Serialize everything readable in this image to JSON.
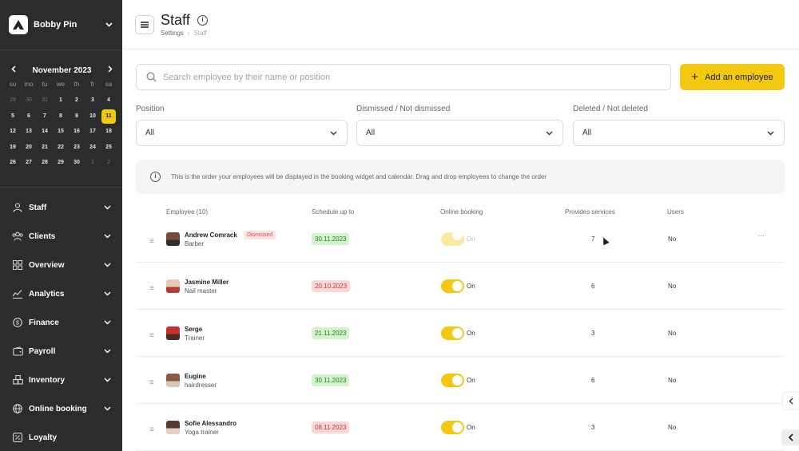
{
  "account": {
    "name": "Bobby Pin"
  },
  "calendar": {
    "month_label": "November 2023",
    "prev_icon": "chevron-left-icon",
    "next_icon": "chevron-right-icon",
    "weekdays": [
      "su",
      "mo",
      "tu",
      "we",
      "th",
      "fr",
      "sa"
    ],
    "weeks": [
      [
        "29",
        "30",
        "31",
        "1",
        "2",
        "3",
        "4"
      ],
      [
        "5",
        "6",
        "7",
        "8",
        "9",
        "10",
        "11"
      ],
      [
        "12",
        "13",
        "14",
        "15",
        "16",
        "17",
        "18"
      ],
      [
        "19",
        "20",
        "21",
        "22",
        "23",
        "24",
        "25"
      ],
      [
        "26",
        "27",
        "28",
        "29",
        "30",
        "1",
        "2"
      ]
    ],
    "selected_day": "11"
  },
  "nav": {
    "items": [
      {
        "label": "Staff",
        "icon": "user-icon"
      },
      {
        "label": "Clients",
        "icon": "users-icon"
      },
      {
        "label": "Overview",
        "icon": "grid-icon"
      },
      {
        "label": "Analytics",
        "icon": "analytics-icon"
      },
      {
        "label": "Finance",
        "icon": "dollar-icon"
      },
      {
        "label": "Payroll",
        "icon": "wallet-icon"
      },
      {
        "label": "Inventory",
        "icon": "box-icon"
      },
      {
        "label": "Online booking",
        "icon": "globe-icon"
      },
      {
        "label": "Loyalty",
        "icon": "percent-icon"
      }
    ]
  },
  "header": {
    "title": "Staff",
    "breadcrumb": [
      "Settings",
      "Staff"
    ]
  },
  "search": {
    "placeholder": "Search employee by their name or position"
  },
  "add_button": {
    "label": "Add an employee"
  },
  "filters": [
    {
      "label": "Position",
      "value": "All"
    },
    {
      "label": "Dismissed / Not dismissed",
      "value": "All"
    },
    {
      "label": "Deleted / Not deleted",
      "value": "All"
    }
  ],
  "notice": {
    "text": "This is the order your employees will be displayed in the booking widget and calendar. Drag and drop employees to change the order"
  },
  "table": {
    "headers": {
      "employee": "Employee (10)",
      "schedule": "Schedule up to",
      "online": "Online booking",
      "services": "Provides services",
      "users": "Users"
    },
    "rows": [
      {
        "name": "Andrew Comrack",
        "position": "Barber",
        "badge": "Dismissed",
        "schedule": "30.11.2023",
        "schedule_ok": true,
        "online": "On",
        "online_enabled": false,
        "services": "7",
        "users": "No",
        "more": "···"
      },
      {
        "name": "Jasmine Miller",
        "position": "Nail master",
        "badge": "",
        "schedule": "20.10.2023",
        "schedule_ok": false,
        "online": "On",
        "online_enabled": true,
        "services": "6",
        "users": "No",
        "more": ""
      },
      {
        "name": "Serge",
        "position": "Trainer",
        "badge": "",
        "schedule": "21.11.2023",
        "schedule_ok": true,
        "online": "On",
        "online_enabled": true,
        "services": "3",
        "users": "No",
        "more": ""
      },
      {
        "name": "Eugine",
        "position": "hairdresser",
        "badge": "",
        "schedule": "30.11.2023",
        "schedule_ok": true,
        "online": "On",
        "online_enabled": true,
        "services": "6",
        "users": "No",
        "more": ""
      },
      {
        "name": "Sofie Alessandro",
        "position": "Yoga trainer",
        "badge": "",
        "schedule": "08.11.2023",
        "schedule_ok": false,
        "online": "On",
        "online_enabled": true,
        "services": "3",
        "users": "No",
        "more": ""
      }
    ]
  },
  "colors": {
    "accent": "#f2c811",
    "sidebar": "#2b2c2e",
    "ok_bg": "#d3f3cc",
    "bad_bg": "#fbd8d8"
  }
}
